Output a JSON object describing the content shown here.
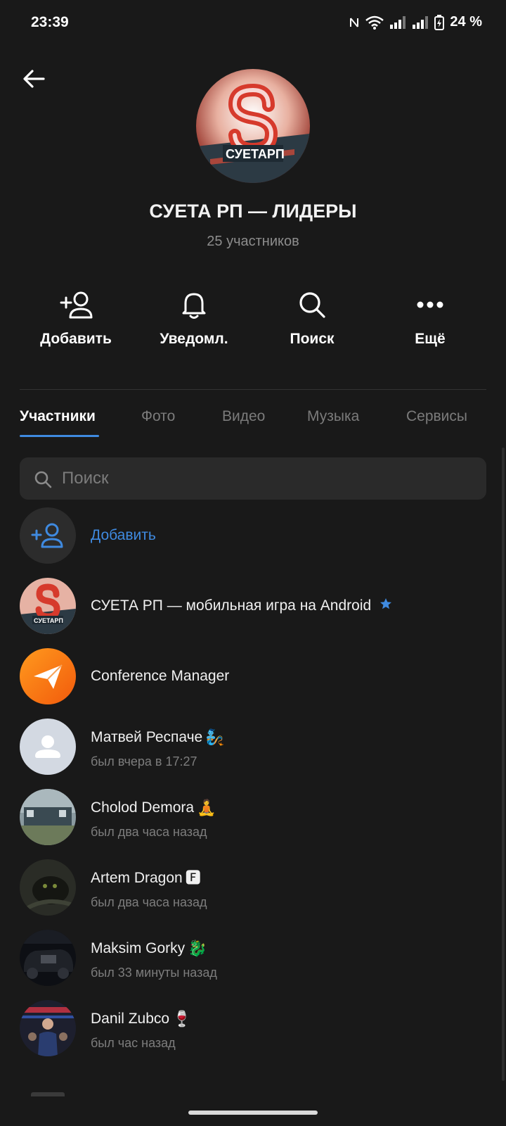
{
  "status_bar": {
    "time": "23:39",
    "battery": "24 %"
  },
  "header": {
    "back_icon": "arrow-left-icon",
    "group_title": "СУЕТА РП — ЛИДЕРЫ",
    "members_count": "25 участников",
    "avatar_text": "СУЕТАРП"
  },
  "actions": [
    {
      "label": "Добавить",
      "icon": "add-user-icon"
    },
    {
      "label": "Уведомл.",
      "icon": "bell-icon"
    },
    {
      "label": "Поиск",
      "icon": "search-icon"
    },
    {
      "label": "Ещё",
      "icon": "more-icon"
    }
  ],
  "tabs": [
    {
      "label": "Участники",
      "active": true
    },
    {
      "label": "Фото"
    },
    {
      "label": "Видео"
    },
    {
      "label": "Музыка"
    },
    {
      "label": "Сервисы"
    }
  ],
  "search": {
    "placeholder": "Поиск"
  },
  "add_member": {
    "label": "Добавить"
  },
  "members": [
    {
      "name": "СУЕТА РП — мобильная игра на Android",
      "status": "",
      "badge": "star-icon"
    },
    {
      "name": "Conference Manager",
      "status": ""
    },
    {
      "name": "Матвей Респаче",
      "status": "был вчера в 17:27",
      "emoji": "🧞"
    },
    {
      "name": "Cholod Demora",
      "status": "был два часа назад",
      "emoji": "🧘"
    },
    {
      "name": "Artem Dragon",
      "status": "был два часа назад",
      "emoji": "🅵"
    },
    {
      "name": "Maksim Gorky",
      "status": "был 33 минуты назад",
      "emoji": "🐉"
    },
    {
      "name": "Danil Zubco",
      "status": "был час назад",
      "emoji": "🍷"
    }
  ],
  "colors": {
    "background": "#191919",
    "accent": "#3f8ae0",
    "muted": "#7d7d7d"
  }
}
